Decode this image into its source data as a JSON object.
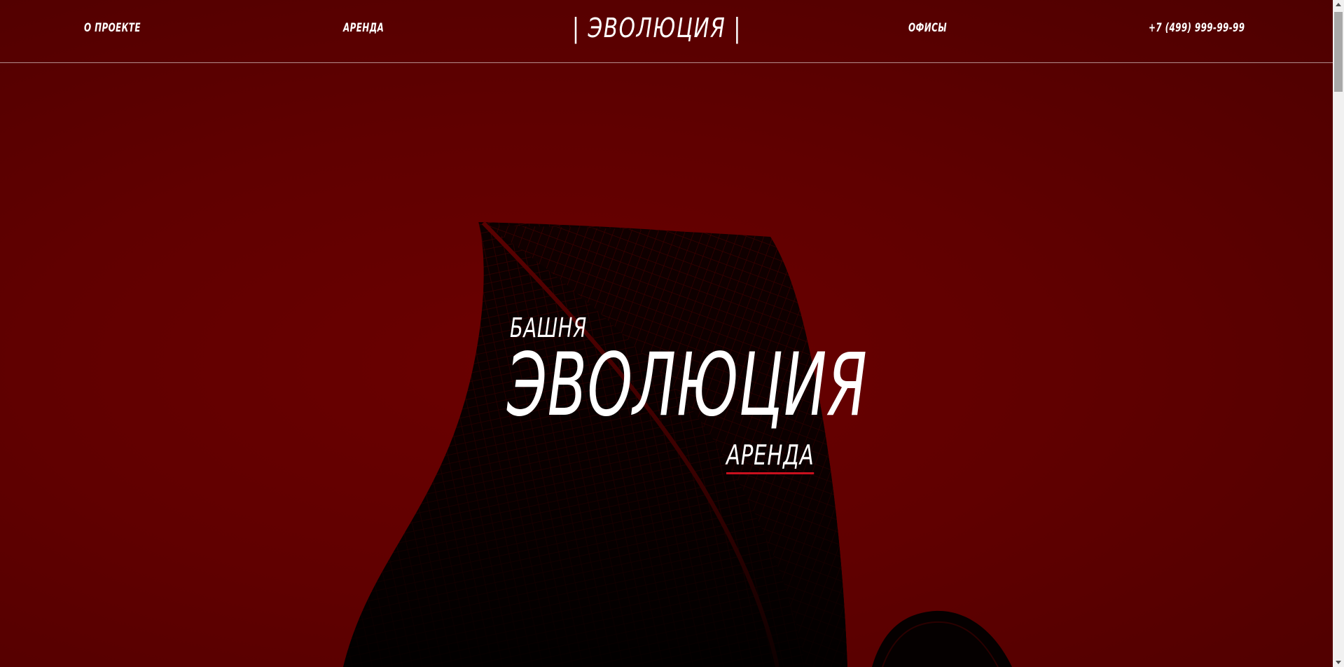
{
  "header": {
    "nav_left": [
      {
        "label": "О ПРОЕКТЕ"
      },
      {
        "label": "АРЕНДА"
      }
    ],
    "logo": "| ЭВОЛЮЦИЯ |",
    "nav_right": [
      {
        "label": "ОФИСЫ"
      },
      {
        "label": "+7 (499) 999-99-99"
      }
    ]
  },
  "hero": {
    "kicker": "БАШНЯ",
    "title": "ЭВОЛЮЦИЯ",
    "link": "АРЕНДА",
    "background_image": "tower-silhouette-icon"
  },
  "colors": {
    "background": "#600000",
    "text": "#ffffff",
    "accent_underline": "#c8101e",
    "silhouette": "#000000"
  }
}
